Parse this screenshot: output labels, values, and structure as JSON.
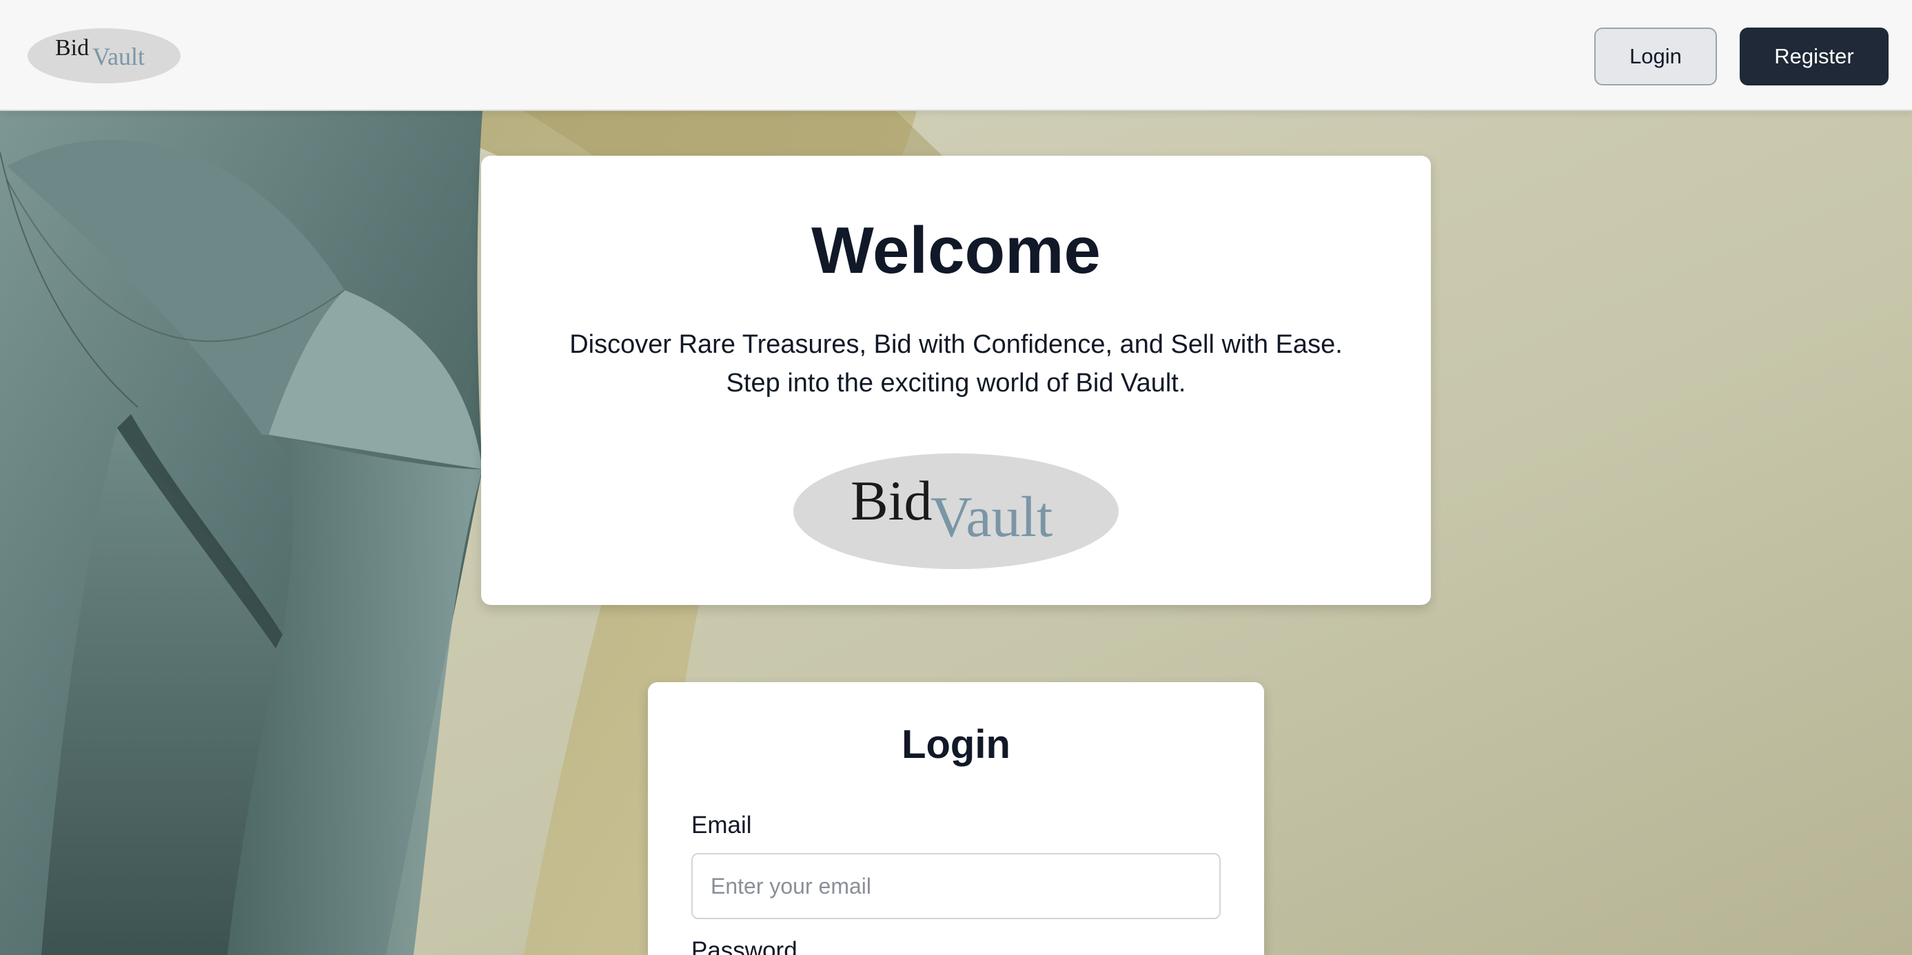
{
  "brand": {
    "logo_text_primary": "Bid",
    "logo_text_secondary": "Vault"
  },
  "navbar": {
    "login_label": "Login",
    "register_label": "Register"
  },
  "welcome": {
    "title": "Welcome",
    "line1": "Discover Rare Treasures, Bid with Confidence, and Sell with Ease.",
    "line2": "Step into the exciting world of Bid Vault."
  },
  "login_form": {
    "title": "Login",
    "email_label": "Email",
    "email_placeholder": "Enter your email",
    "email_value": "",
    "password_label": "Password"
  },
  "colors": {
    "primary_dark": "#1f2937",
    "text_dark": "#111827",
    "logo_oval": "#d9d9d9",
    "logo_vault": "#7a96a6",
    "background_beige": "#cdccb4",
    "background_teal": "#5f7a78"
  }
}
